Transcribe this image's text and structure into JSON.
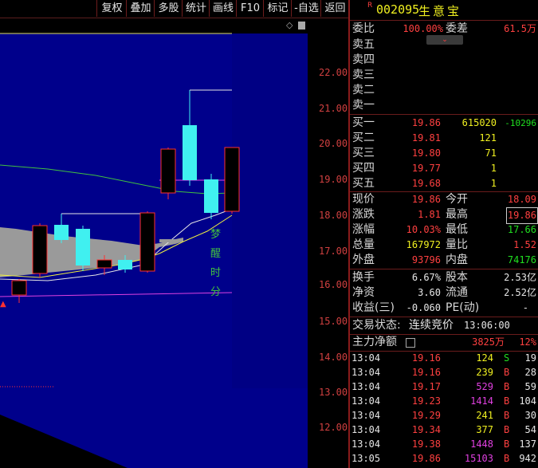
{
  "toolbar": {
    "buttons": [
      "复权",
      "叠加",
      "多股",
      "统计",
      "画线",
      "F10",
      "标记",
      "-自选",
      "返回"
    ]
  },
  "chart": {
    "price_labels": [
      "22.00",
      "21.00",
      "20.00",
      "19.00",
      "18.00",
      "17.00",
      "16.00",
      "15.00",
      "14.00",
      "13.00",
      "12.00"
    ],
    "annotation": [
      "梦",
      "醒",
      "时",
      "分"
    ],
    "colors": {
      "bg_main": "#00008b",
      "up": "#ff3030",
      "down": "#40f0f0",
      "ma1": "#e0e040",
      "ma2": "#e040e0",
      "ma3": "#40c040"
    }
  },
  "header": {
    "badge": "R",
    "code": "002095",
    "name": "生意宝"
  },
  "ratio": {
    "label1": "委比",
    "value1": "100.00%",
    "label2": "委差",
    "value2": "61.5万"
  },
  "sell": [
    {
      "label": "卖五"
    },
    {
      "label": "卖四"
    },
    {
      "label": "卖三"
    },
    {
      "label": "卖二"
    },
    {
      "label": "卖一"
    }
  ],
  "buy": [
    {
      "label": "买一",
      "price": "19.86",
      "vol": "615020",
      "chg": "-10296"
    },
    {
      "label": "买二",
      "price": "19.81",
      "vol": "121",
      "chg": ""
    },
    {
      "label": "买三",
      "price": "19.80",
      "vol": "71",
      "chg": ""
    },
    {
      "label": "买四",
      "price": "19.77",
      "vol": "1",
      "chg": ""
    },
    {
      "label": "买五",
      "price": "19.68",
      "vol": "1",
      "chg": ""
    }
  ],
  "stats": [
    {
      "l1": "现价",
      "v1": "19.86",
      "l2": "今开",
      "v2": "18.09"
    },
    {
      "l1": "涨跌",
      "v1": "1.81",
      "l2": "最高",
      "v2": "19.86"
    },
    {
      "l1": "涨幅",
      "v1": "10.03%",
      "l2": "最低",
      "v2": "17.66"
    },
    {
      "l1": "总量",
      "v1": "167972",
      "l2": "量比",
      "v2": "1.52"
    },
    {
      "l1": "外盘",
      "v1": "93796",
      "l2": "内盘",
      "v2": "74176"
    }
  ],
  "stats2": [
    {
      "l1": "换手",
      "v1": "6.67%",
      "l2": "股本",
      "v2": "2.53亿"
    },
    {
      "l1": "净资",
      "v1": "3.60",
      "l2": "流通",
      "v2": "2.52亿"
    },
    {
      "l1": "收益(三)",
      "v1": "-0.060",
      "l2": "PE(动)",
      "v2": "-"
    }
  ],
  "status": {
    "label": "交易状态:",
    "state": "连续竞价",
    "time": "13:06:00"
  },
  "netflow": {
    "label": "主力净额",
    "value": "3825万",
    "pct": "12%"
  },
  "trades": [
    {
      "t": "13:04",
      "p": "19.16",
      "v": "124",
      "s": "S",
      "n": "19"
    },
    {
      "t": "13:04",
      "p": "19.16",
      "v": "239",
      "s": "B",
      "n": "28"
    },
    {
      "t": "13:04",
      "p": "19.17",
      "v": "529",
      "s": "B",
      "n": "59"
    },
    {
      "t": "13:04",
      "p": "19.23",
      "v": "1414",
      "s": "B",
      "n": "104"
    },
    {
      "t": "13:04",
      "p": "19.29",
      "v": "241",
      "s": "B",
      "n": "30"
    },
    {
      "t": "13:04",
      "p": "19.34",
      "v": "377",
      "s": "B",
      "n": "54"
    },
    {
      "t": "13:04",
      "p": "19.38",
      "v": "1448",
      "s": "B",
      "n": "137"
    },
    {
      "t": "13:05",
      "p": "19.86",
      "v": "15103",
      "s": "B",
      "n": "942"
    }
  ]
}
